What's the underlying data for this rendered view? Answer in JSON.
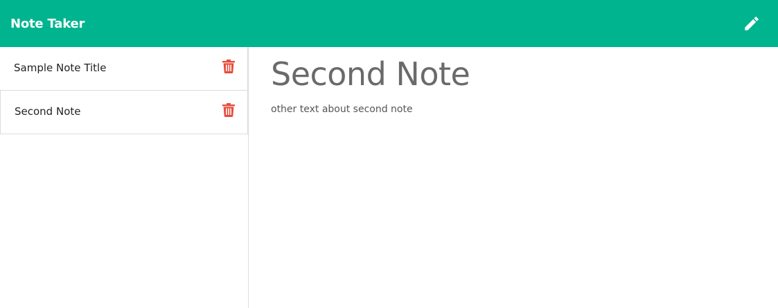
{
  "navbar": {
    "brand": "Note Taker",
    "new_note_icon": "pencil-icon",
    "background_color": "#00b48f"
  },
  "sidebar": {
    "notes": [
      {
        "title": "Sample Note Title",
        "delete_icon": "trash-icon"
      },
      {
        "title": "Second Note",
        "delete_icon": "trash-icon"
      }
    ],
    "delete_icon_color": "#e74c3c"
  },
  "editor": {
    "title": "Second Note",
    "text": "other text about second note"
  }
}
